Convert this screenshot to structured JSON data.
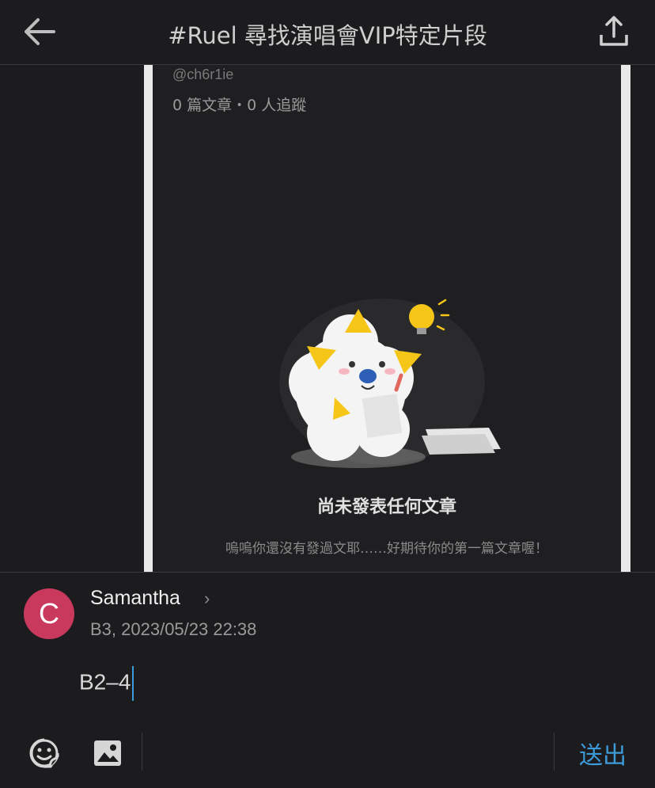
{
  "header": {
    "title": "#Ruel 尋找演唱會VIP特定片段",
    "back_icon": "back-arrow-icon",
    "share_icon": "share-upload-icon"
  },
  "screenshot": {
    "handle": "@ch6r1ie",
    "stats": "0 篇文章・0 人追蹤",
    "empty_title": "尚未發表任何文章",
    "empty_desc": "嗚嗚你還沒有發過文耶……好期待你的第一篇文章喔！"
  },
  "composer": {
    "avatar_letter": "C",
    "author": "Samantha",
    "chevron": "›",
    "meta": "B3, 2023/05/23 22:38",
    "comment_text": "B2–4",
    "send_label": "送出",
    "emoji_icon": "sticker-emoji-icon",
    "image_icon": "image-icon"
  },
  "colors": {
    "background": "#1c1c1e",
    "accent": "#3d9ad8",
    "avatar": "#c9395e"
  }
}
